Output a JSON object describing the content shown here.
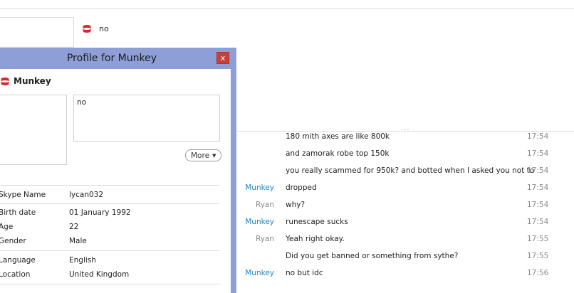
{
  "header": {
    "mood_text": "no"
  },
  "profile": {
    "title": "Profile for Munkey",
    "close_label": "x",
    "name": "Munkey",
    "mood": "no",
    "more_label": "More",
    "fields": [
      {
        "label": "Skype Name",
        "value": "lycan032"
      },
      {
        "label": "Birth date",
        "value": "01 January 1992"
      },
      {
        "label": "Age",
        "value": "22"
      },
      {
        "label": "Gender",
        "value": "Male"
      },
      {
        "label": "Language",
        "value": "English"
      },
      {
        "label": "Location",
        "value": "United Kingdom"
      }
    ]
  },
  "chat": {
    "grip": "...",
    "messages": [
      {
        "sender": "",
        "text": "180 mith axes are like 800k",
        "time": "17:54"
      },
      {
        "sender": "",
        "text": "and zamorak robe top 150k",
        "time": "17:54"
      },
      {
        "sender": "",
        "text": "you really scammed for 950k? and botted when I asked you not to",
        "time": "17:54"
      },
      {
        "sender": "Munkey",
        "text": "dropped",
        "time": "17:54"
      },
      {
        "sender": "Ryan",
        "text": "why?",
        "time": "17:54"
      },
      {
        "sender": "Munkey",
        "text": "runescape sucks",
        "time": "17:54"
      },
      {
        "sender": "Ryan",
        "text": "Yeah right okay.",
        "time": "17:55"
      },
      {
        "sender": "",
        "text": "Did you get banned or something from sythe?",
        "time": "17:55"
      },
      {
        "sender": "Munkey",
        "text": "no but idc",
        "time": "17:56"
      }
    ]
  },
  "colors": {
    "accent_blue": "#1f84c4",
    "status_red": "#d9262e",
    "title_bar": "#8d9fd6"
  },
  "icons": {
    "status": "do-not-disturb-icon"
  }
}
